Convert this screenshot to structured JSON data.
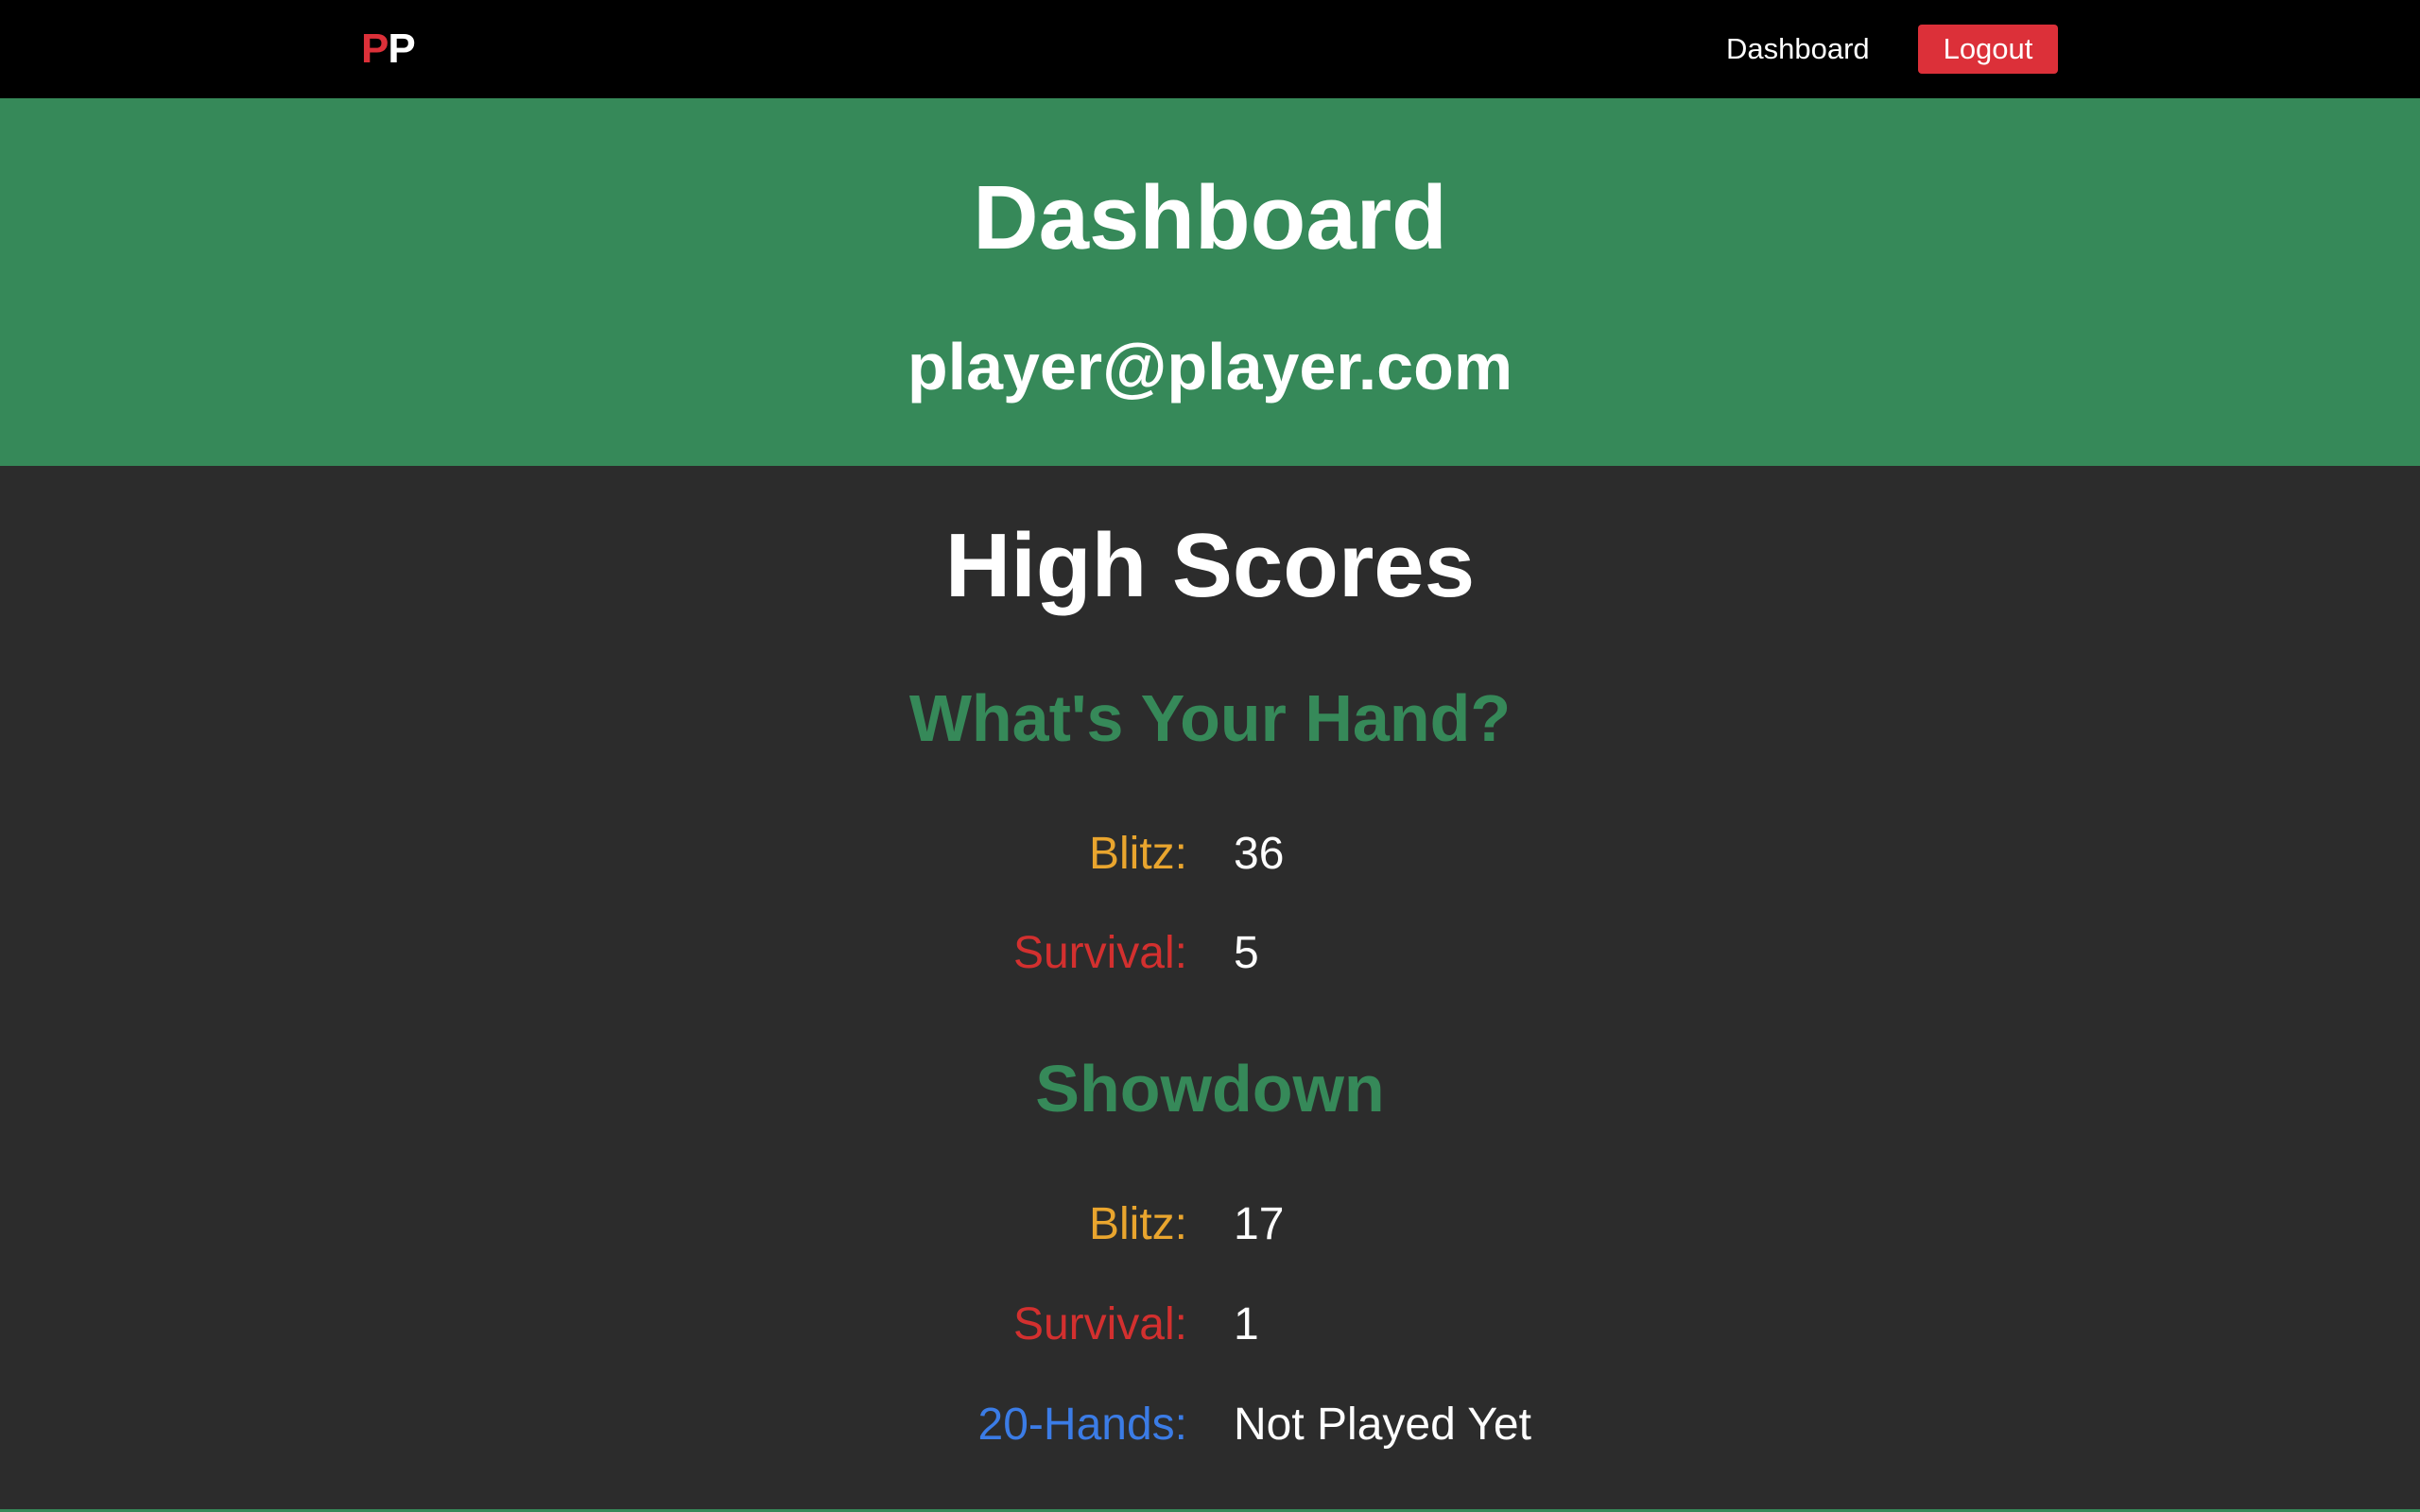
{
  "nav": {
    "logo_left": "P",
    "logo_right": "P",
    "dashboard_link": "Dashboard",
    "logout_label": "Logout"
  },
  "hero": {
    "title": "Dashboard",
    "email": "player@player.com"
  },
  "high_scores": {
    "title": "High Scores",
    "sections": [
      {
        "title": "What's Your Hand?",
        "rows": [
          {
            "label": "Blitz:",
            "value": "36"
          },
          {
            "label": "Survival:",
            "value": "5"
          }
        ]
      },
      {
        "title": "Showdown",
        "rows": [
          {
            "label": "Blitz:",
            "value": "17"
          },
          {
            "label": "Survival:",
            "value": "1"
          },
          {
            "label": "20-Hands:",
            "value": "Not Played Yet"
          }
        ]
      }
    ]
  },
  "colors": {
    "navbar": "#000000",
    "brand_red": "#dc3039",
    "hero_green": "#368959",
    "background": "#2c2c2c",
    "blitz_label": "#e9a52e",
    "survival_label": "#d3302f",
    "twenty_hands_label": "#3b7ce6"
  }
}
